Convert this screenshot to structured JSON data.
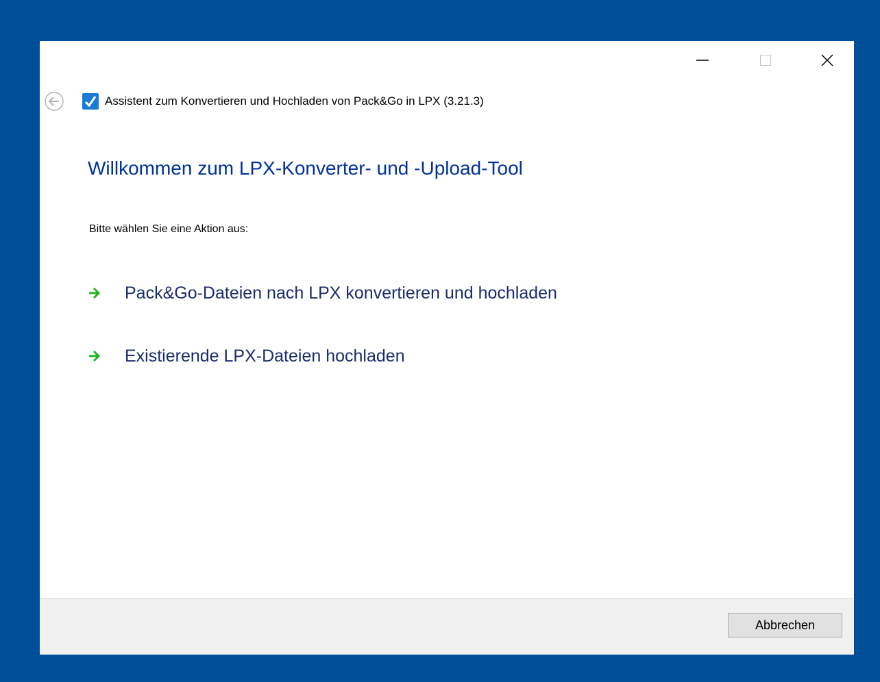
{
  "window": {
    "caption_buttons": {
      "minimize_icon": "minimize-icon",
      "maximize_icon": "maximize-icon",
      "close_icon": "close-icon"
    }
  },
  "header": {
    "back_icon": "back-arrow-icon",
    "app_icon": "checkmark-icon",
    "title": "Assistent zum Konvertieren und Hochladen von Pack&Go in LPX (3.21.3)"
  },
  "main": {
    "heading": "Willkommen zum LPX-Konverter- und -Upload-Tool",
    "prompt": "Bitte wählen Sie eine Aktion aus:",
    "command_links": [
      {
        "icon": "green-arrow-icon",
        "label": "Pack&Go-Dateien nach LPX konvertieren und hochladen"
      },
      {
        "icon": "green-arrow-icon",
        "label": "Existierende LPX-Dateien hochladen"
      }
    ]
  },
  "footer": {
    "cancel_label": "Abbrechen"
  },
  "colors": {
    "desktop": "#004e98",
    "heading": "#003399",
    "command_link": "#1b2c6b",
    "arrow": "#23b523",
    "app_icon": "#1a7bd6"
  }
}
